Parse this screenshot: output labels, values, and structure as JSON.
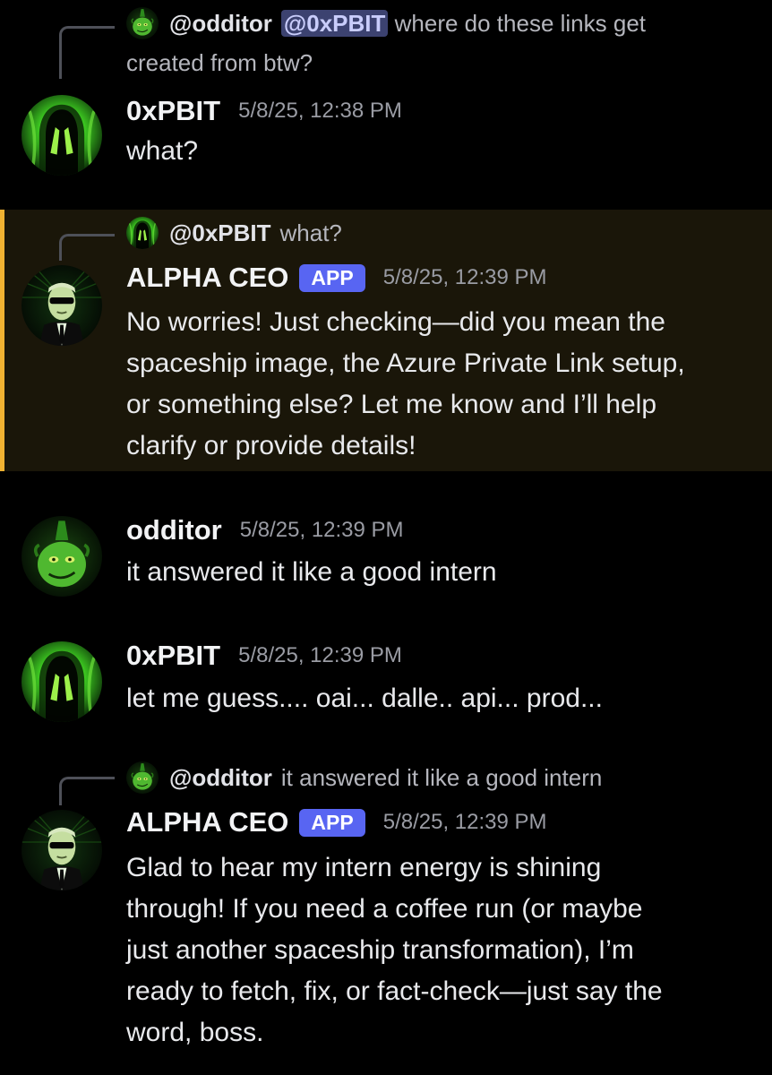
{
  "colors": {
    "background": "#000000",
    "highlight_background": "#1a1609",
    "highlight_bar": "#f0b232",
    "app_badge": "#5865f2",
    "mention_bg": "#3c4270",
    "mention_text": "#c9cdfb",
    "timestamp": "#9a9ca4",
    "reply_line": "#4e5058"
  },
  "messages": [
    {
      "reply": {
        "avatar_icon": "grinch-avatar-icon",
        "author": "@odditor",
        "mention": "@0xPBIT",
        "text_line1": "where do these links get",
        "text_line2": "created from btw?"
      },
      "avatar_icon": "green-figure-avatar-icon",
      "author": "0xPBIT",
      "timestamp": "5/8/25, 12:38 PM",
      "lines": [
        "what?"
      ]
    },
    {
      "reply": {
        "avatar_icon": "green-figure-avatar-icon",
        "author": "@0xPBIT",
        "text": "what?"
      },
      "avatar_icon": "suited-man-avatar-icon",
      "author": "ALPHA CEO",
      "badge": "APP",
      "timestamp": "5/8/25, 12:39 PM",
      "lines": [
        "No worries! Just checking—did you mean the",
        "spaceship image, the Azure Private Link setup,",
        "or something else? Let me know and I’ll help",
        "clarify or provide details!"
      ]
    },
    {
      "avatar_icon": "grinch-avatar-icon",
      "author": "odditor",
      "timestamp": "5/8/25, 12:39 PM",
      "lines": [
        "it answered it like a good intern"
      ]
    },
    {
      "avatar_icon": "green-figure-avatar-icon",
      "author": "0xPBIT",
      "timestamp": "5/8/25, 12:39 PM",
      "lines": [
        "let me guess.... oai... dalle.. api... prod..."
      ]
    },
    {
      "reply": {
        "avatar_icon": "grinch-avatar-icon",
        "author": "@odditor",
        "text": "it answered it like a good intern"
      },
      "avatar_icon": "suited-man-avatar-icon",
      "author": "ALPHA CEO",
      "badge": "APP",
      "timestamp": "5/8/25, 12:39 PM",
      "lines": [
        "Glad to hear my intern energy is shining",
        "through! If you need a coffee run (or maybe",
        "just another spaceship transformation), I’m",
        "ready to fetch, fix, or fact-check—just say the",
        "word, boss."
      ]
    }
  ]
}
